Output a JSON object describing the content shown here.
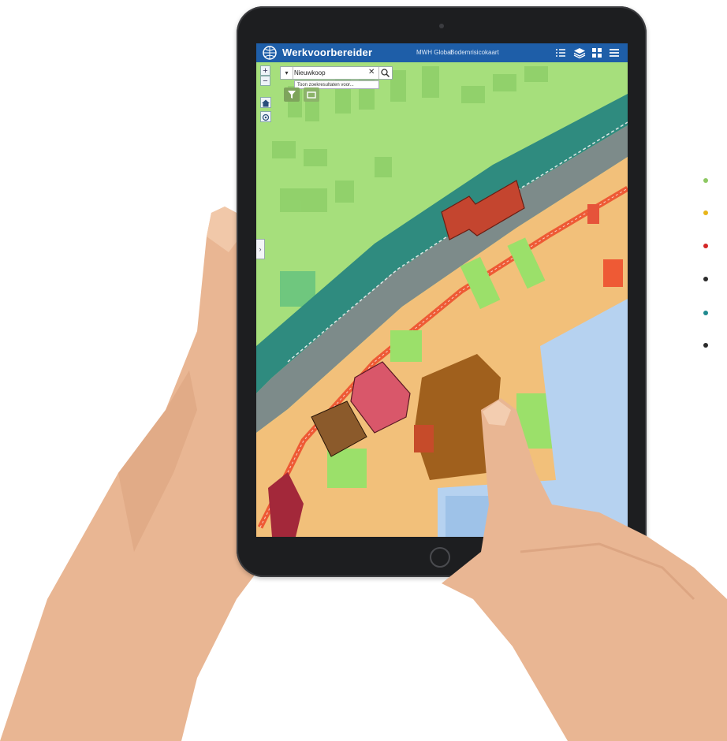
{
  "app": {
    "title": "Werkvoorbereider",
    "header_links": [
      "MWH Global",
      "Bodemrisicokaart"
    ],
    "header_icons": [
      "legend-list-icon",
      "layers-icon",
      "grid-icon",
      "menu-icon"
    ]
  },
  "search": {
    "value": "Nieuwkoop",
    "hint": "Toon zoekresultaten voor..."
  },
  "map_controls": {
    "zoom_in": "+",
    "zoom_out": "−",
    "side_toggle": "›"
  },
  "colors": {
    "header": "#1e5ea8",
    "legend": [
      "#8dc862",
      "#e8b51a",
      "#d42626",
      "#2b2b2b",
      "#1f8a8f",
      "#2b2b2b"
    ]
  }
}
